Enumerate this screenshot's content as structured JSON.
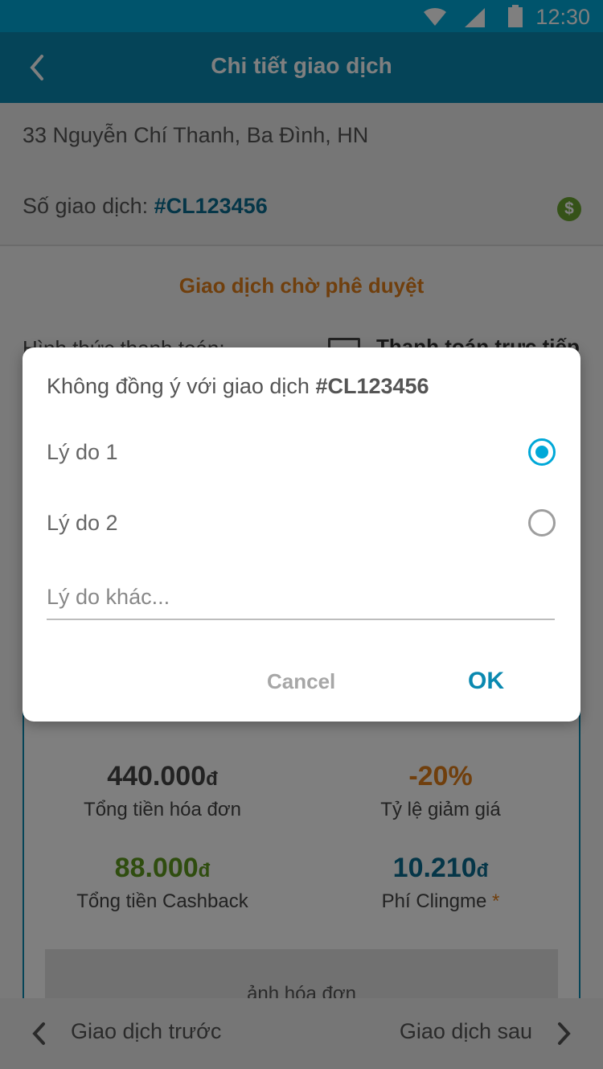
{
  "status_bar": {
    "time": "12:30",
    "icons": [
      "wifi-icon",
      "signal-icon",
      "battery-icon"
    ]
  },
  "app_bar": {
    "title": "Chi tiết giao dịch",
    "back_icon": "chevron-left-icon"
  },
  "store": {
    "address": "33 Nguyễn Chí Thanh, Ba Đình, HN",
    "tx_label": "Số giao dịch: ",
    "tx_id": "#CL123456",
    "cashback_icon": "dollar-icon"
  },
  "transaction": {
    "status": "Giao dịch chờ phê duyệt",
    "payment_label": "Hình thức thanh toán:",
    "payment_value": "Thanh toán trực tiếp"
  },
  "summary": {
    "total": {
      "value": "440.000",
      "currency": "đ",
      "label": "Tổng tiền hóa đơn"
    },
    "discount": {
      "value": "-20%",
      "label": "Tỷ lệ giảm giá"
    },
    "cashback": {
      "value": "88.000",
      "currency": "đ",
      "label": "Tổng tiền Cashback"
    },
    "fee": {
      "value": "10.210",
      "currency": "đ",
      "label": "Phí Clingme",
      "asterisk": "*"
    },
    "invoice_label": "ảnh hóa đơn"
  },
  "bottom_nav": {
    "prev_label": "Giao dịch trước",
    "next_label": "Giao dịch sau"
  },
  "dialog": {
    "title_prefix": "Không đồng ý với giao dịch ",
    "title_id": "#CL123456",
    "reasons": [
      {
        "label": "Lý do 1",
        "selected": true
      },
      {
        "label": "Lý do 2",
        "selected": false
      }
    ],
    "other_placeholder": "Lý do khác...",
    "other_value": "",
    "cancel_label": "Cancel",
    "ok_label": "OK"
  },
  "colors": {
    "status_bar": "#00a8d8",
    "app_bar": "#0a89b0",
    "pending": "#e07e1a",
    "cashback": "#5f9a1f",
    "fee": "#0a6d90"
  }
}
